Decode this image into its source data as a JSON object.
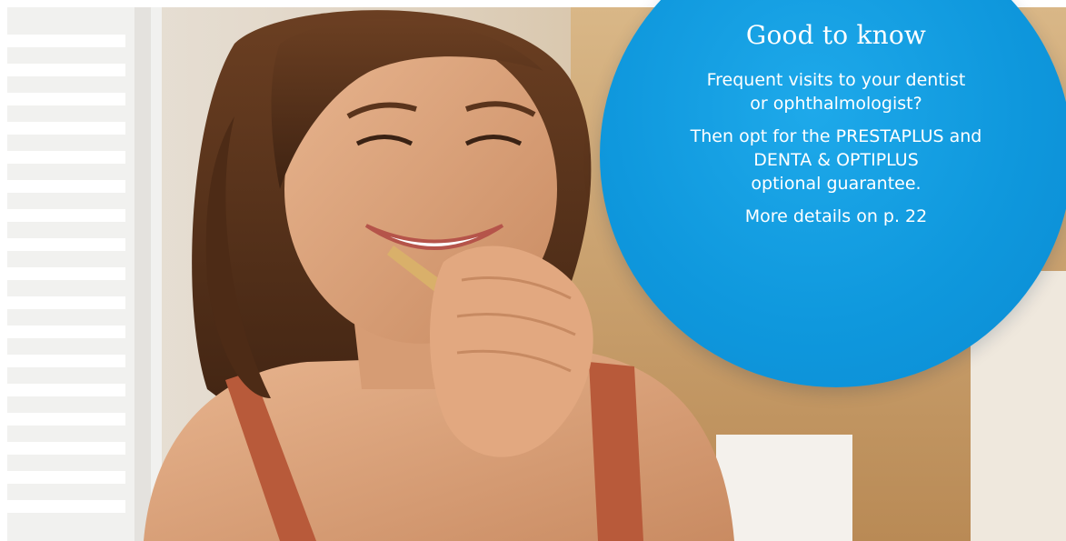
{
  "info_bubble": {
    "title": "Good to know",
    "paragraph_1": [
      "Frequent visits to your dentist",
      "or ophthalmologist?"
    ],
    "paragraph_2": [
      "Then opt for the PRESTAPLUS and",
      "DENTA & OPTIPLUS",
      "optional guarantee."
    ],
    "paragraph_3": "More details on p. 22",
    "color": "#0f98dd"
  },
  "photo": {
    "subject": "woman-brushing-teeth-photo"
  }
}
